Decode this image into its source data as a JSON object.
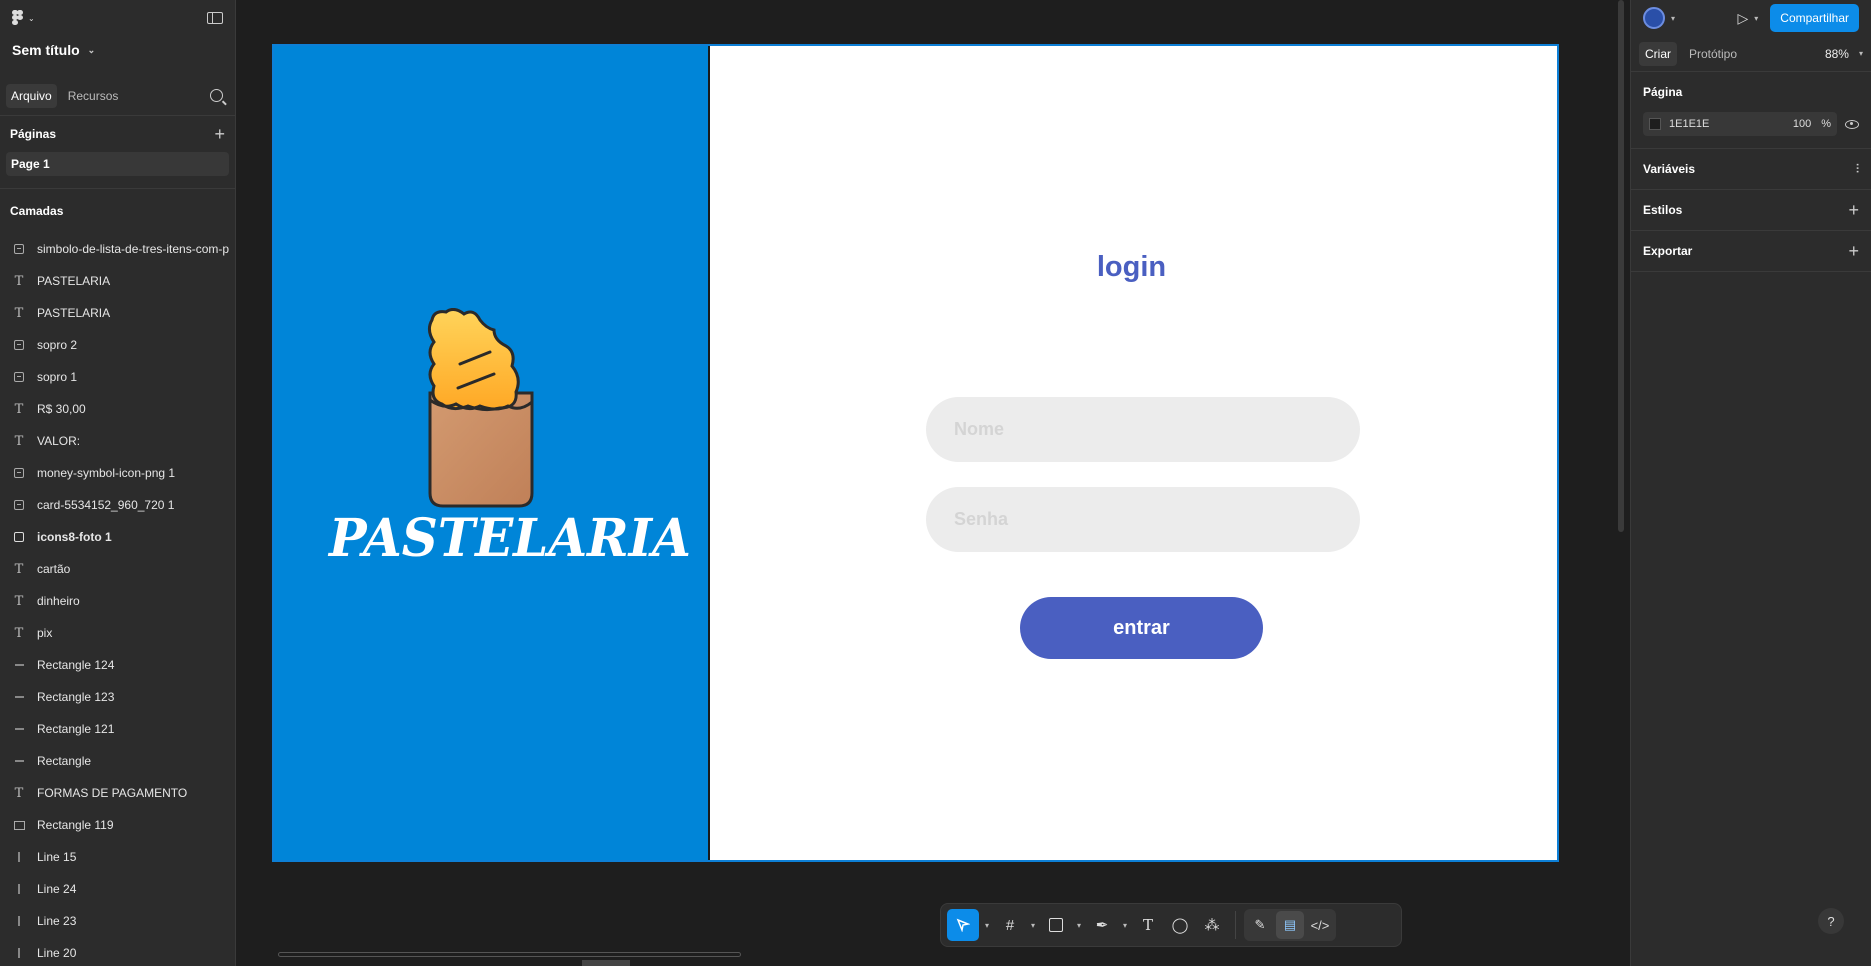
{
  "file": {
    "title": "Sem título"
  },
  "left_tabs": {
    "file": "Arquivo",
    "assets": "Recursos"
  },
  "pages": {
    "header": "Páginas",
    "items": [
      "Page 1"
    ]
  },
  "layers": {
    "header": "Camadas",
    "items": [
      {
        "icon": "image-icon",
        "label": "simbolo-de-lista-de-tres-itens-com-p"
      },
      {
        "icon": "text-icon",
        "label": "PASTELARIA"
      },
      {
        "icon": "text-icon",
        "label": "PASTELARIA"
      },
      {
        "icon": "image-icon",
        "label": "sopro 2"
      },
      {
        "icon": "image-icon",
        "label": "sopro 1"
      },
      {
        "icon": "text-icon",
        "label": "R$ 30,00"
      },
      {
        "icon": "text-icon",
        "label": "VALOR:"
      },
      {
        "icon": "image-icon",
        "label": "money-symbol-icon-png 1"
      },
      {
        "icon": "image-icon",
        "label": "card-5534152_960_720 1"
      },
      {
        "icon": "frame-icon",
        "label": "icons8-foto 1"
      },
      {
        "icon": "text-icon",
        "label": "cartão"
      },
      {
        "icon": "text-icon",
        "label": "dinheiro"
      },
      {
        "icon": "text-icon",
        "label": "pix"
      },
      {
        "icon": "line-icon",
        "label": "Rectangle 124"
      },
      {
        "icon": "line-icon",
        "label": "Rectangle 123"
      },
      {
        "icon": "line-icon",
        "label": "Rectangle 121"
      },
      {
        "icon": "line-icon",
        "label": "Rectangle"
      },
      {
        "icon": "text-icon",
        "label": "FORMAS DE PAGAMENTO"
      },
      {
        "icon": "rectangle-icon",
        "label": "Rectangle 119"
      },
      {
        "icon": "vline-icon",
        "label": "Line 15"
      },
      {
        "icon": "vline-icon",
        "label": "Line 24"
      },
      {
        "icon": "vline-icon",
        "label": "Line 23"
      },
      {
        "icon": "vline-icon",
        "label": "Line 20"
      }
    ]
  },
  "design": {
    "brand": "PASTELARIA",
    "login_title": "login",
    "name_placeholder": "Nome",
    "password_placeholder": "Senha",
    "enter_label": "entrar",
    "colors": {
      "left_panel": "#0085d8",
      "accent": "#4a5fc1",
      "field": "#ececec"
    }
  },
  "toolbar": {
    "tools": [
      "move-icon",
      "frame-icon",
      "rectangle-icon",
      "pen-icon",
      "text-icon",
      "comment-icon",
      "actions-icon"
    ],
    "modes": [
      "draw-mode-icon",
      "design-mode-icon",
      "dev-mode-icon"
    ]
  },
  "right": {
    "share_label": "Compartilhar",
    "tabs": {
      "design": "Criar",
      "prototype": "Protótipo"
    },
    "zoom": "88%",
    "page_section": "Página",
    "bg_color": "1E1E1E",
    "opacity": "100",
    "opacity_unit": "%",
    "variables": "Variáveis",
    "styles": "Estilos",
    "export": "Exportar",
    "help": "?"
  }
}
